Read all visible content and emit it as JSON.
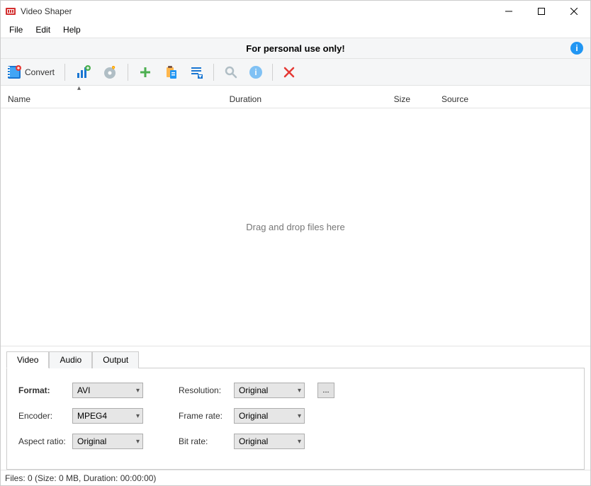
{
  "window": {
    "title": "Video Shaper"
  },
  "menu": {
    "file": "File",
    "edit": "Edit",
    "help": "Help"
  },
  "banner": {
    "text": "For personal use only!"
  },
  "toolbar": {
    "convert": "Convert"
  },
  "columns": {
    "name": "Name",
    "duration": "Duration",
    "size": "Size",
    "source": "Source"
  },
  "list": {
    "empty_text": "Drag and drop files here"
  },
  "tabs": {
    "video": "Video",
    "audio": "Audio",
    "output": "Output"
  },
  "video_form": {
    "format_label": "Format:",
    "format_value": "AVI",
    "encoder_label": "Encoder:",
    "encoder_value": "MPEG4",
    "aspect_label": "Aspect ratio:",
    "aspect_value": "Original",
    "resolution_label": "Resolution:",
    "resolution_value": "Original",
    "framerate_label": "Frame rate:",
    "framerate_value": "Original",
    "bitrate_label": "Bit rate:",
    "bitrate_value": "Original",
    "browse": "..."
  },
  "status": {
    "text": "Files: 0 (Size: 0 MB, Duration: 00:00:00)"
  }
}
